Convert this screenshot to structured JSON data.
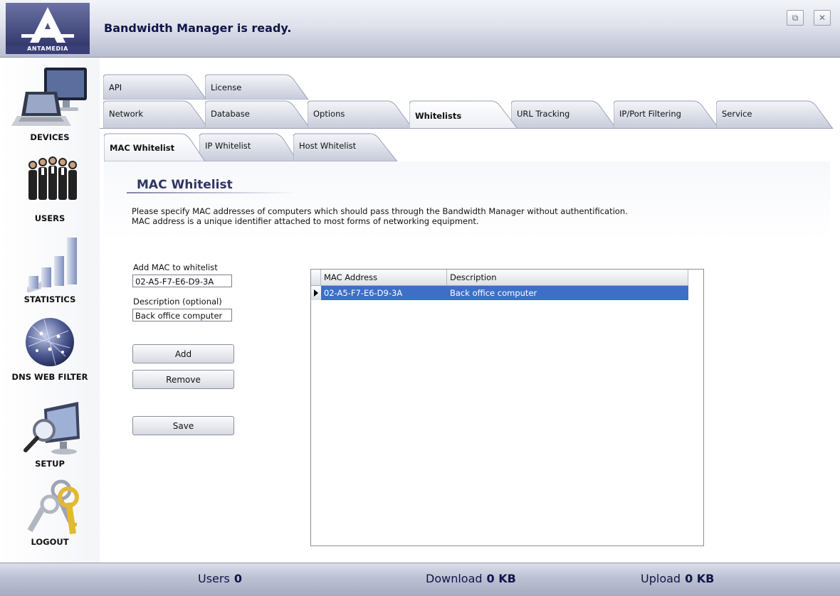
{
  "app": {
    "logo_text": "ANTAMEDIA",
    "status_title": "Bandwidth Manager is ready."
  },
  "window_controls": {
    "restore_icon": "restore-icon",
    "close_icon": "close-icon"
  },
  "sidebar": {
    "items": [
      {
        "label": "DEVICES",
        "icon": "laptop-monitor-icon"
      },
      {
        "label": "USERS",
        "icon": "people-group-icon"
      },
      {
        "label": "STATISTICS",
        "icon": "bar-chart-icon"
      },
      {
        "label": "DNS WEB FILTER",
        "icon": "globe-network-icon"
      },
      {
        "label": "SETUP",
        "icon": "monitor-magnifier-icon"
      },
      {
        "label": "LOGOUT",
        "icon": "keys-icon"
      }
    ]
  },
  "tabs": {
    "row1": [
      "API",
      "License"
    ],
    "row2": [
      "Network",
      "Database",
      "Options",
      "Whitelists",
      "URL Tracking",
      "IP/Port Filtering",
      "Service"
    ],
    "active_main": "Whitelists",
    "sub": [
      "MAC Whitelist",
      "IP Whitelist",
      "Host Whitelist"
    ],
    "active_sub": "MAC Whitelist"
  },
  "section": {
    "title": "MAC Whitelist",
    "desc_line1": "Please specify MAC addresses of computers which should pass through the Bandwidth Manager without authentification.",
    "desc_line2": "MAC address is a unique identifier attached to most forms of networking equipment."
  },
  "form": {
    "mac_label": "Add MAC to whitelist",
    "mac_value": "02-A5-F7-E6-D9-3A",
    "desc_label": "Description (optional)",
    "desc_value": "Back office computer",
    "add_label": "Add",
    "remove_label": "Remove",
    "save_label": "Save"
  },
  "grid": {
    "columns": [
      "MAC Address",
      "Description"
    ],
    "rows": [
      {
        "mac": "02-A5-F7-E6-D9-3A",
        "description": "Back office computer",
        "selected": true
      }
    ]
  },
  "footer": {
    "users_label": "Users",
    "users_value": "0",
    "download_label": "Download",
    "download_value": "0 KB",
    "upload_label": "Upload",
    "upload_value": "0 KB"
  },
  "colors": {
    "title_text": "#10154a",
    "selection": "#3d6fc6",
    "header_gradient": "#b9bed0"
  }
}
